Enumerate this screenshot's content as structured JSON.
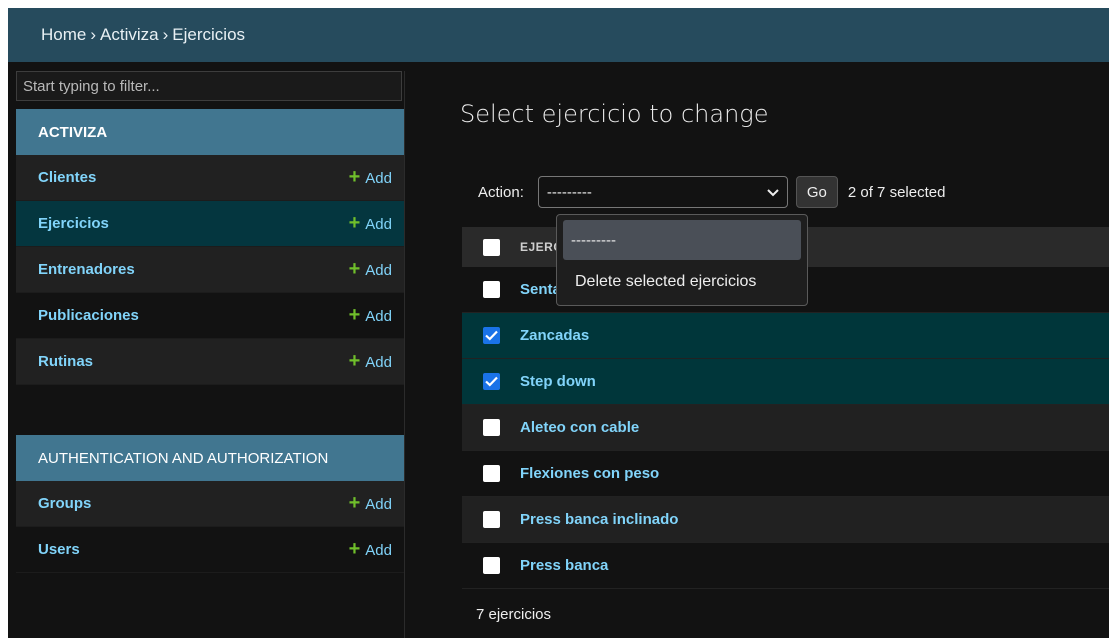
{
  "breadcrumbs": {
    "home": "Home",
    "sep": "›",
    "app": "Activiza",
    "current": "Ejercicios"
  },
  "sidebar": {
    "filter_placeholder": "Start typing to filter...",
    "module1": {
      "title": "ACTIVIZA",
      "items": [
        {
          "label": "Clientes",
          "add": "Add"
        },
        {
          "label": "Ejercicios",
          "add": "Add"
        },
        {
          "label": "Entrenadores",
          "add": "Add"
        },
        {
          "label": "Publicaciones",
          "add": "Add"
        },
        {
          "label": "Rutinas",
          "add": "Add"
        }
      ]
    },
    "module2": {
      "title": "AUTHENTICATION AND AUTHORIZATION",
      "items": [
        {
          "label": "Groups",
          "add": "Add"
        },
        {
          "label": "Users",
          "add": "Add"
        }
      ]
    }
  },
  "main": {
    "title": "Select ejercicio to change",
    "action_label": "Action:",
    "action_value": "---------",
    "go_label": "Go",
    "selection_count": "2 of 7 selected",
    "column_header": "EJERCICIO",
    "rows": [
      {
        "label": "Sentadillas",
        "checked": false
      },
      {
        "label": "Zancadas",
        "checked": true
      },
      {
        "label": "Step down",
        "checked": true
      },
      {
        "label": "Aleteo con cable",
        "checked": false
      },
      {
        "label": "Flexiones con peso",
        "checked": false
      },
      {
        "label": "Press banca inclinado",
        "checked": false
      },
      {
        "label": "Press banca",
        "checked": false
      }
    ],
    "paginator": "7 ejercicios"
  },
  "dropdown": {
    "options": [
      "---------",
      "Delete selected ejercicios"
    ]
  },
  "colors": {
    "header_bg": "#264b5d",
    "module_bg": "#417690",
    "link": "#81d4fa",
    "add_plus": "#70bf2b",
    "selected_row": "#00363a"
  }
}
